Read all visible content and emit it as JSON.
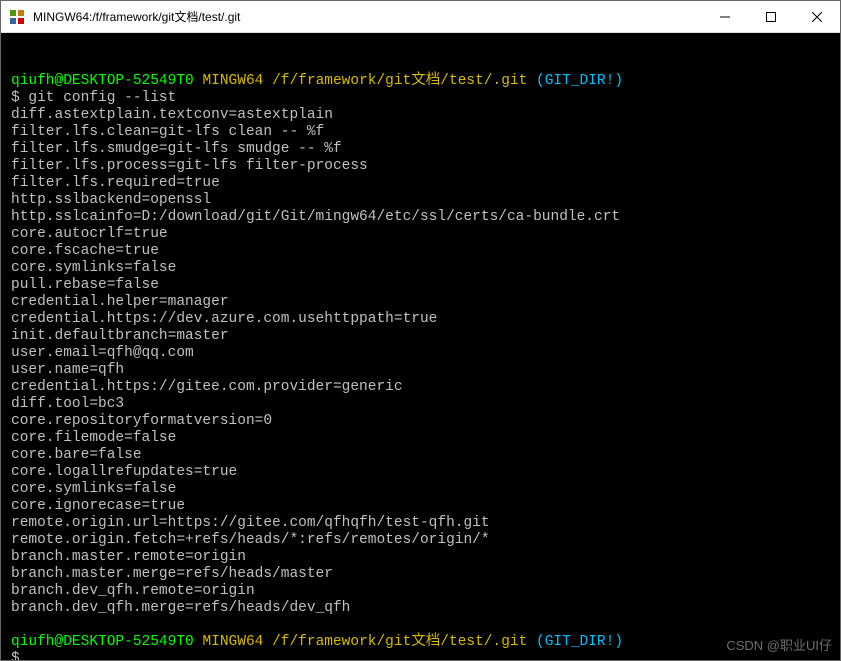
{
  "colors": {
    "user": "#00ff00",
    "path": "#d7ba00",
    "paren": "#00bfff"
  },
  "title": "MINGW64:/f/framework/git文档/test/.git",
  "prompt": {
    "user_host": "qiufh@DESKTOP-52549T0",
    "env": "MINGW64",
    "path": "/f/framework/git文档/test/.git",
    "paren": "(GIT_DIR!)",
    "dollar": "$"
  },
  "command": "git config --list",
  "output": [
    "diff.astextplain.textconv=astextplain",
    "filter.lfs.clean=git-lfs clean -- %f",
    "filter.lfs.smudge=git-lfs smudge -- %f",
    "filter.lfs.process=git-lfs filter-process",
    "filter.lfs.required=true",
    "http.sslbackend=openssl",
    "http.sslcainfo=D:/download/git/Git/mingw64/etc/ssl/certs/ca-bundle.crt",
    "core.autocrlf=true",
    "core.fscache=true",
    "core.symlinks=false",
    "pull.rebase=false",
    "credential.helper=manager",
    "credential.https://dev.azure.com.usehttppath=true",
    "init.defaultbranch=master",
    "user.email=qfh@qq.com",
    "user.name=qfh",
    "credential.https://gitee.com.provider=generic",
    "diff.tool=bc3",
    "core.repositoryformatversion=0",
    "core.filemode=false",
    "core.bare=false",
    "core.logallrefupdates=true",
    "core.symlinks=false",
    "core.ignorecase=true",
    "remote.origin.url=https://gitee.com/qfhqfh/test-qfh.git",
    "remote.origin.fetch=+refs/heads/*:refs/remotes/origin/*",
    "branch.master.remote=origin",
    "branch.master.merge=refs/heads/master",
    "branch.dev_qfh.remote=origin",
    "branch.dev_qfh.merge=refs/heads/dev_qfh"
  ],
  "watermark": "CSDN @职业UI仔"
}
